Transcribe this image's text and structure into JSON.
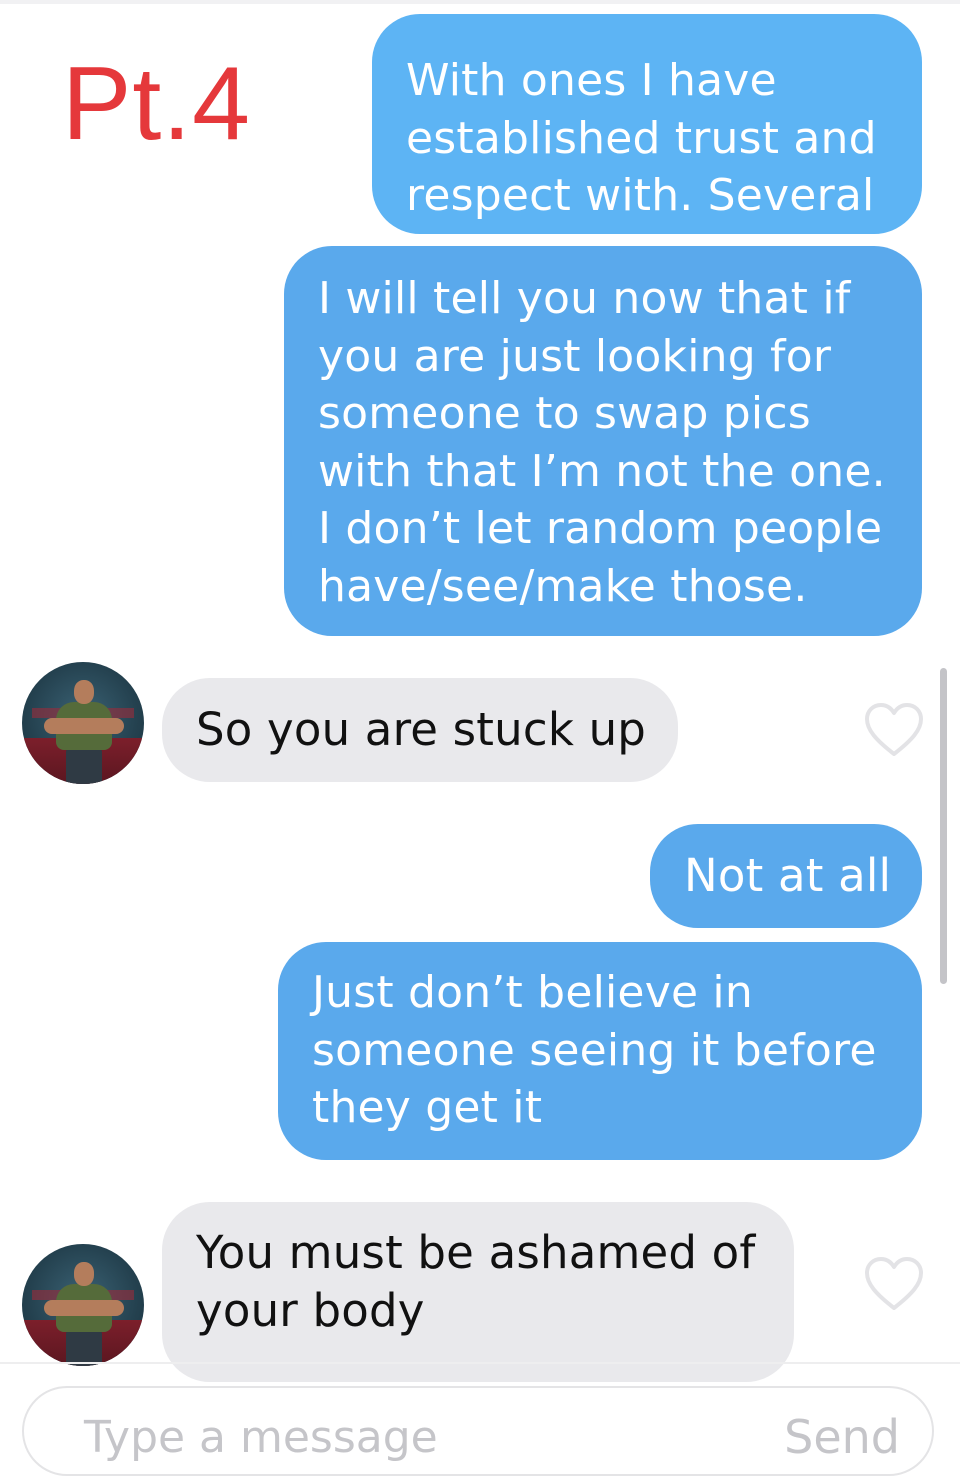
{
  "overlay": {
    "label": "Pt.4"
  },
  "messages": [
    {
      "sender": "me",
      "text": "With ones I have\nestablished trust and\nrespect with. Several"
    },
    {
      "sender": "me",
      "text": "I will tell you now that if\nyou are just looking for\nsomeone to swap pics\nwith that I’m not the one.\nI don’t let random people\nhave/see/make those."
    },
    {
      "sender": "match",
      "text": "So you are stuck up"
    },
    {
      "sender": "me",
      "text": "Not at all"
    },
    {
      "sender": "me",
      "text": "Just don’t believe in\nsomeone seeing it before\nthey get it"
    },
    {
      "sender": "match",
      "text": "You must be ashamed of\nyour body"
    }
  ],
  "composer": {
    "placeholder": "Type a message",
    "send_label": "Send"
  },
  "colors": {
    "outgoing_bubble": "#5aa9ec",
    "incoming_bubble": "#e9e9ec",
    "overlay_label": "#e5383b"
  },
  "icons": {
    "like": "heart-icon",
    "avatar": "avatar"
  }
}
